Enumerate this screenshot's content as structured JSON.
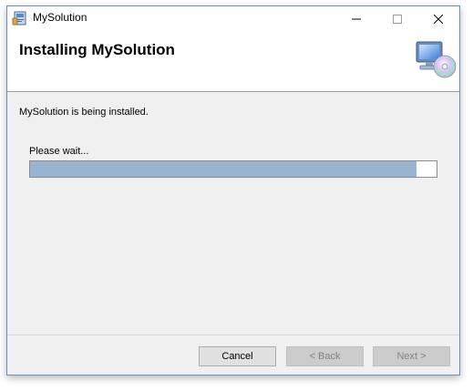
{
  "window": {
    "title": "MySolution",
    "minimize_icon": "minimize-icon",
    "maximize_icon": "maximize-icon",
    "close_icon": "close-icon"
  },
  "header": {
    "title": "Installing MySolution",
    "icon": "computer-disc-icon"
  },
  "body": {
    "status_text": "MySolution is being installed.",
    "wait_text": "Please wait...",
    "progress_fraction": 0.95
  },
  "footer": {
    "cancel_label": "Cancel",
    "back_label": "< Back",
    "next_label": "Next >"
  },
  "colors": {
    "progress_fill": "#99b4d1",
    "window_border": "#6d8cbf"
  }
}
